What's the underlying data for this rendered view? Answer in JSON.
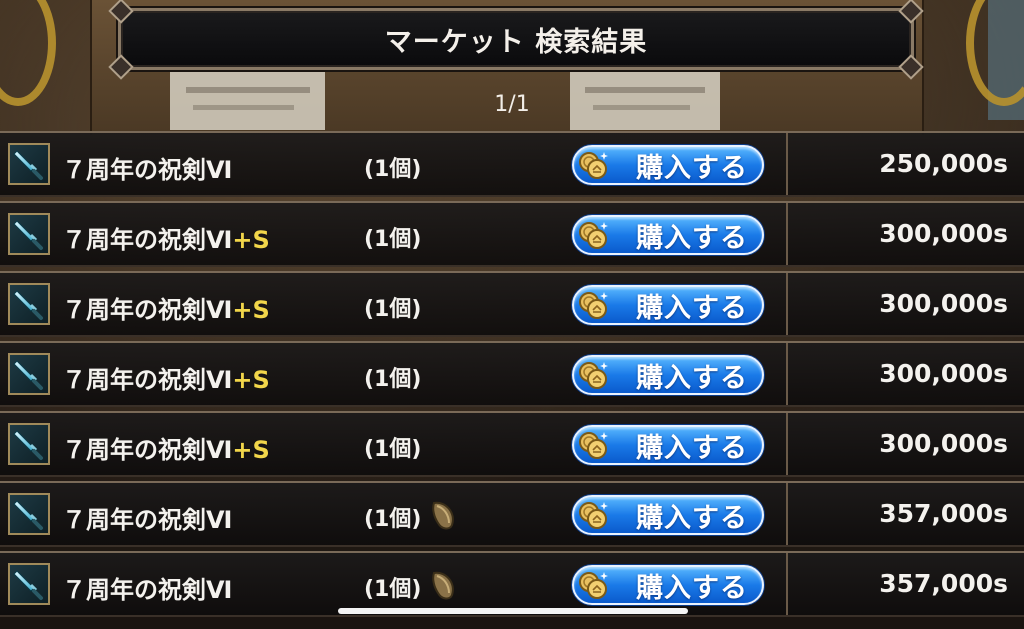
{
  "header": {
    "title": "マーケット 検索結果",
    "page": "1/1"
  },
  "buy_label": "購入する",
  "colors": {
    "accent_plus": "#f2d64a",
    "button_blue": "#1a7ae8"
  },
  "rows": [
    {
      "name": "７周年の祝剣Ⅵ",
      "plus": "",
      "qty": "(1個)",
      "seed": false,
      "price": "250,000s"
    },
    {
      "name": "７周年の祝剣Ⅵ",
      "plus": "+S",
      "qty": "(1個)",
      "seed": false,
      "price": "300,000s"
    },
    {
      "name": "７周年の祝剣Ⅵ",
      "plus": "+S",
      "qty": "(1個)",
      "seed": false,
      "price": "300,000s"
    },
    {
      "name": "７周年の祝剣Ⅵ",
      "plus": "+S",
      "qty": "(1個)",
      "seed": false,
      "price": "300,000s"
    },
    {
      "name": "７周年の祝剣Ⅵ",
      "plus": "+S",
      "qty": "(1個)",
      "seed": false,
      "price": "300,000s"
    },
    {
      "name": "７周年の祝剣Ⅵ",
      "plus": "",
      "qty": "(1個)",
      "seed": true,
      "price": "357,000s"
    },
    {
      "name": "７周年の祝剣Ⅵ",
      "plus": "",
      "qty": "(1個)",
      "seed": true,
      "price": "357,000s"
    }
  ]
}
